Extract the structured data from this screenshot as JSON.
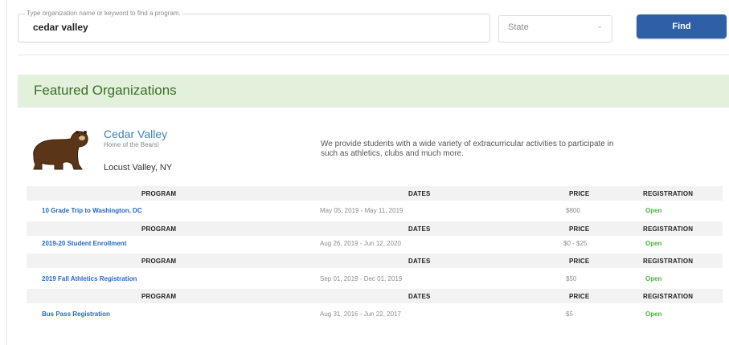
{
  "search": {
    "legend": "Type organization name or keyword to find a program.",
    "value": "cedar valley",
    "state_label": "State",
    "find_label": "Find"
  },
  "featured": {
    "title": "Featured Organizations"
  },
  "organization": {
    "name": "Cedar Valley",
    "tagline": "Home of the Bears!",
    "location": "Locust Valley, NY",
    "description_lines": [
      "We provide students with a wide variety of extracurricular activities to participate in",
      "such as athletics, clubs and much more."
    ]
  },
  "table": {
    "headers": {
      "program": "PROGRAM",
      "dates": "DATES",
      "price": "PRICE",
      "registration": "REGISTRATION"
    },
    "rows": [
      {
        "program": "10 Grade Trip to Washington, DC",
        "dates": "May 05, 2019 - May 11, 2019",
        "price": "$800",
        "registration": "Open"
      },
      {
        "program": "2019-20 Student Enrollment",
        "dates": "Aug 26, 2019 - Jun 12, 2020",
        "price": "$0 - $25",
        "registration": "Open"
      },
      {
        "program": "2019 Fall Athletics Registration",
        "dates": "Sep 01, 2019 - Dec 01, 2019",
        "price": "$50",
        "registration": "Open"
      },
      {
        "program": "Bus Pass Registration",
        "dates": "Aug 31, 2016 - Jun 22, 2017",
        "price": "$5",
        "registration": "Open"
      }
    ]
  }
}
